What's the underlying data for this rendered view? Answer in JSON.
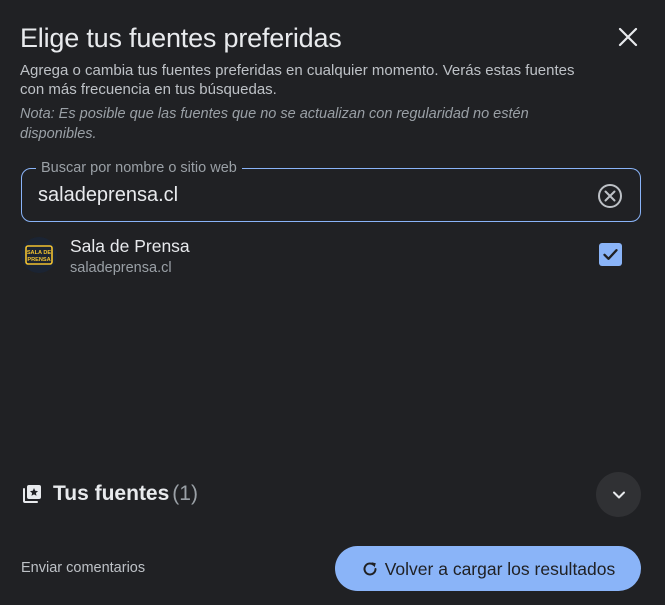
{
  "dialog": {
    "title": "Elige tus fuentes preferidas",
    "description": "Agrega o cambia tus fuentes preferidas en cualquier momento. Verás estas fuentes con más frecuencia en tus búsquedas.",
    "note": "Nota: Es posible que las fuentes que no se actualizan con regularidad no estén disponibles.",
    "close_icon": "close-icon"
  },
  "search": {
    "label": "Buscar por nombre o sitio web",
    "value": "saladeprensa.cl",
    "clear_icon": "clear-circle-icon"
  },
  "results": [
    {
      "name": "Sala de Prensa",
      "domain": "saladeprensa.cl",
      "logo_text": "SALA DE PRENSA",
      "checked": true
    }
  ],
  "your_sources": {
    "label": "Tus fuentes",
    "count": "(1)",
    "icon": "star-stack-icon",
    "expand_icon": "chevron-down-icon"
  },
  "footer": {
    "feedback_label": "Enviar comentarios",
    "reload_label": "Volver a cargar los resultados",
    "reload_icon": "refresh-icon"
  },
  "colors": {
    "background": "#202124",
    "accent": "#8ab4f8",
    "text_primary": "#e8eaed",
    "text_secondary": "#9aa0a6"
  }
}
